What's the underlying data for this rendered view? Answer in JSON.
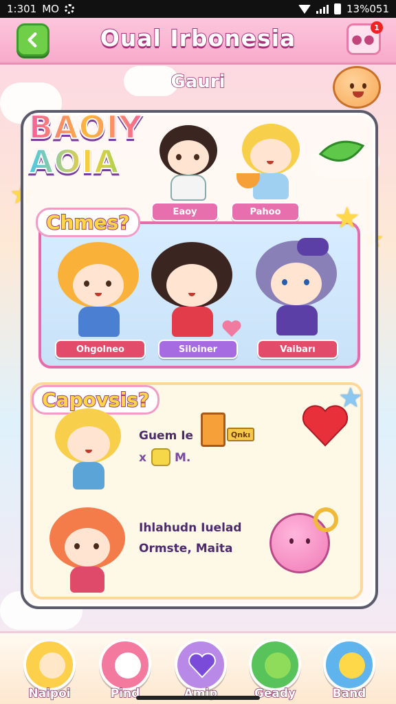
{
  "status_bar": {
    "time": "1:301",
    "carrier": "MO",
    "battery": "13%051"
  },
  "header": {
    "title": "Oual Irbonesia",
    "badge_count": "1",
    "menu_icon": "ellipsis-icon",
    "back_icon": "back-arrow-icon"
  },
  "subtitle": "Gauri",
  "logo": {
    "line1": "BAOIY",
    "line2": "AOIA"
  },
  "top_characters": [
    {
      "name": "Eaoy"
    },
    {
      "name": "Pahoo"
    }
  ],
  "section1": {
    "title": "Chmes?",
    "characters": [
      {
        "name": "Ohgolneo",
        "hair": "#f9b13a",
        "outfit": "#4a7fd1"
      },
      {
        "name": "Siloiner",
        "hair": "#3a2520",
        "outfit": "#e23b4a"
      },
      {
        "name": "Vaibarı",
        "hair": "#8a80b8",
        "outfit": "#5b3fa6"
      }
    ]
  },
  "section2": {
    "title": "Capovsis?",
    "items": [
      {
        "line1": "Guem Ie",
        "line2": "x",
        "line2b": "M.",
        "tag": "Qnkı"
      },
      {
        "line1": "Ihlahudn Iuelad",
        "line2": "Ormste, Maita"
      }
    ]
  },
  "bottom_nav": [
    {
      "label": "Naipoi",
      "color": "#fcd04a"
    },
    {
      "label": "Pind",
      "color": "#f37a9e"
    },
    {
      "label": "Amip",
      "color": "#b989e8"
    },
    {
      "label": "Geady",
      "color": "#58c35b"
    },
    {
      "label": "Band",
      "color": "#5fb4ee"
    }
  ],
  "colors": {
    "header_bg": "#f8aacb",
    "accent_pink": "#e76fae",
    "accent_purple": "#a66be0",
    "accent_red": "#e34b6a"
  }
}
